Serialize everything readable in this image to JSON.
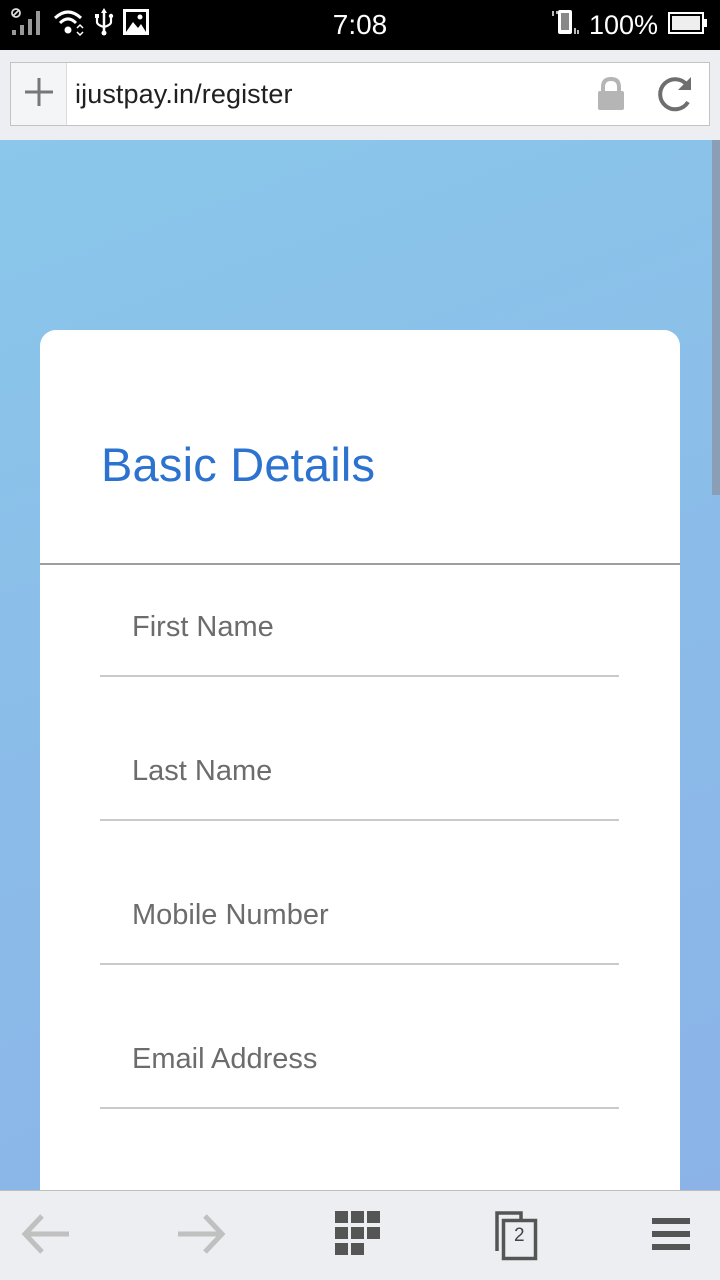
{
  "status_bar": {
    "time": "7:08",
    "battery_percent": "100%",
    "icons": [
      "no-sim-signal-icon",
      "wifi-icon",
      "usb-icon",
      "image-icon",
      "vibrate-icon",
      "battery-icon"
    ]
  },
  "browser": {
    "url": "ijustpay.in/register",
    "icons": {
      "new_tab": "plus-icon",
      "secure": "lock-icon",
      "reload": "reload-icon"
    }
  },
  "page": {
    "card_title": "Basic Details",
    "fields": [
      {
        "name": "first-name",
        "placeholder": "First Name",
        "value": ""
      },
      {
        "name": "last-name",
        "placeholder": "Last Name",
        "value": ""
      },
      {
        "name": "mobile-number",
        "placeholder": "Mobile Number",
        "value": ""
      },
      {
        "name": "email-address",
        "placeholder": "Email Address",
        "value": ""
      }
    ],
    "colors": {
      "title": "#2c72cf",
      "background_start": "#8ac7ea",
      "background_end": "#8bb3e8"
    }
  },
  "bottom_nav": {
    "open_tabs_count": "2",
    "items": [
      "back-arrow-icon",
      "forward-arrow-icon",
      "speed-dial-icon",
      "tabs-icon",
      "menu-icon"
    ]
  }
}
